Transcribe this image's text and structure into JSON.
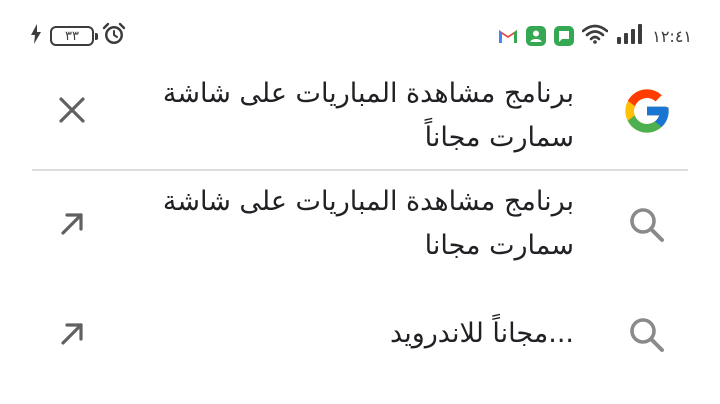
{
  "status_bar": {
    "battery_level": "٣٣",
    "time": "١٢:٤١",
    "icons": [
      "charging-bolt-icon",
      "alarm-clock-icon",
      "gmail-icon",
      "contacts-icon",
      "messages-icon",
      "wifi-icon",
      "signal-icon"
    ]
  },
  "search": {
    "query": "برنامج مشاهدة المباريات على شاشة سمارت مجاناً"
  },
  "suggestions": [
    {
      "text": "برنامج مشاهدة المباريات على شاشة سمارت مجانا"
    },
    {
      "text": "...مجاناً للاندرويد"
    }
  ],
  "colors": {
    "google_blue": "#4285F4",
    "google_red": "#EA4335",
    "google_yellow": "#FBBC05",
    "google_green": "#34A853",
    "icon_gray": "#757575",
    "divider": "#dadce0"
  }
}
